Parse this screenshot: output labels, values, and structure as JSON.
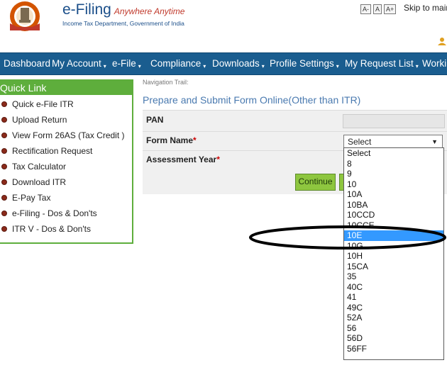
{
  "header": {
    "brand_main": "e-Filing",
    "brand_tagline": "Anywhere Anytime",
    "brand_subtitle": "Income Tax Department, Government of India",
    "font_controls": [
      "A-",
      "A",
      "A+"
    ],
    "skip_link": "Skip to main"
  },
  "nav": {
    "items": [
      {
        "label": "Dashboard",
        "dropdown": false
      },
      {
        "label": "My Account",
        "dropdown": true
      },
      {
        "label": "e-File",
        "dropdown": true
      },
      {
        "label": "Compliance",
        "dropdown": true
      },
      {
        "label": "Downloads",
        "dropdown": true
      },
      {
        "label": "Profile Settings",
        "dropdown": true
      },
      {
        "label": "My Request List",
        "dropdown": true
      },
      {
        "label": "Worki",
        "dropdown": false
      }
    ]
  },
  "quick_link": {
    "title": "Quick Link",
    "items": [
      "Quick e-File ITR",
      "Upload Return",
      "View Form 26AS (Tax Credit )",
      "Rectification Request",
      "Tax Calculator",
      "Download ITR",
      "E-Pay Tax",
      "e-Filing - Dos & Don'ts",
      "ITR V - Dos & Don'ts"
    ]
  },
  "main": {
    "nav_trail": "Navigation Trail:",
    "title": "Prepare and Submit Form Online(Other than ITR)",
    "fields": {
      "pan_label": "PAN",
      "form_name_label": "Form Name",
      "assessment_year_label": "Assessment Year",
      "required_marker": "*"
    },
    "continue_button": "Continue",
    "form_name_select": {
      "selected_value": "Select",
      "highlighted_option": "10E",
      "options": [
        "Select",
        "8",
        "9",
        "10",
        "10A",
        "10BA",
        "10CCD",
        "10CCE",
        "10E",
        "10G",
        "10H",
        "15CA",
        "35",
        "40C",
        "41",
        "49C",
        "52A",
        "56",
        "56D",
        "56FF"
      ]
    }
  },
  "colors": {
    "nav_bar": "#1a5d8f",
    "quick_link_green": "#5eae3c",
    "continue_button": "#8ec63f",
    "title_blue": "#4a7ab0",
    "option_highlight": "#3399ff"
  }
}
